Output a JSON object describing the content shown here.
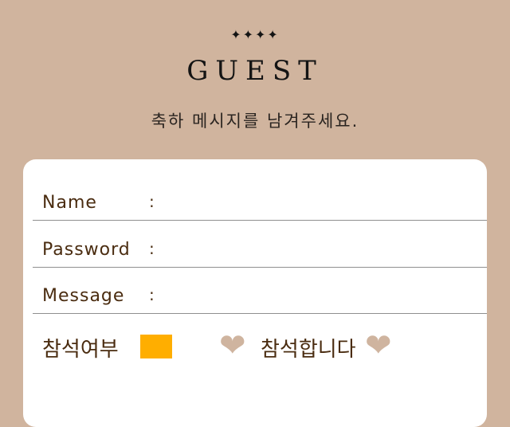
{
  "header": {
    "stars": "✦✦✦✦",
    "title": "GUEST",
    "subtitle": "축하 메시지를 남겨주세요."
  },
  "form": {
    "fields": [
      {
        "label": "Name",
        "colon": ":",
        "value": ""
      },
      {
        "label": "Password",
        "colon": ":",
        "value": ""
      },
      {
        "label": "Message",
        "colon": ":",
        "value": ""
      }
    ],
    "attendance": {
      "label": "참석여부",
      "option_text": "참석합니다",
      "heart_left": "❤",
      "heart_right": "❤",
      "box_color": "#ffae00"
    }
  },
  "colors": {
    "background": "#d0b49e",
    "card": "#ffffff",
    "label_text": "#4a2c10",
    "heart": "#cfb49f"
  }
}
